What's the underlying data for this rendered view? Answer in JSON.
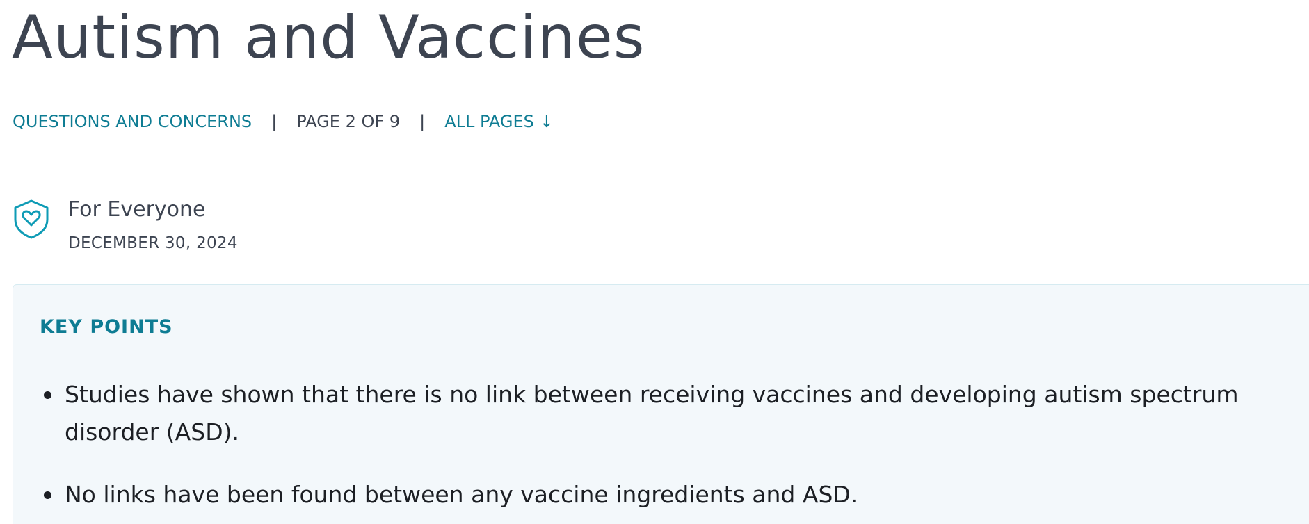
{
  "page": {
    "title": "Autism and Vaccines"
  },
  "breadcrumb": {
    "section_link": "QUESTIONS AND CONCERNS",
    "separator": "|",
    "page_indicator": "PAGE 2 OF 9",
    "all_pages_link": "ALL PAGES",
    "all_pages_arrow": "↓"
  },
  "audience": {
    "icon": "shield-heart-icon",
    "label": "For Everyone",
    "date": "DECEMBER 30, 2024"
  },
  "key_points": {
    "title": "KEY POINTS",
    "items": [
      "Studies have shown that there is no link between receiving vaccines and developing autism spectrum disorder (ASD).",
      "No links have been found between any vaccine ingredients and ASD."
    ]
  },
  "colors": {
    "accent": "#0e7c93",
    "heading_text": "#3d4451",
    "body_text": "#1c1f24",
    "callout_background": "#f3f8fb",
    "callout_border": "#d6ebf1"
  }
}
